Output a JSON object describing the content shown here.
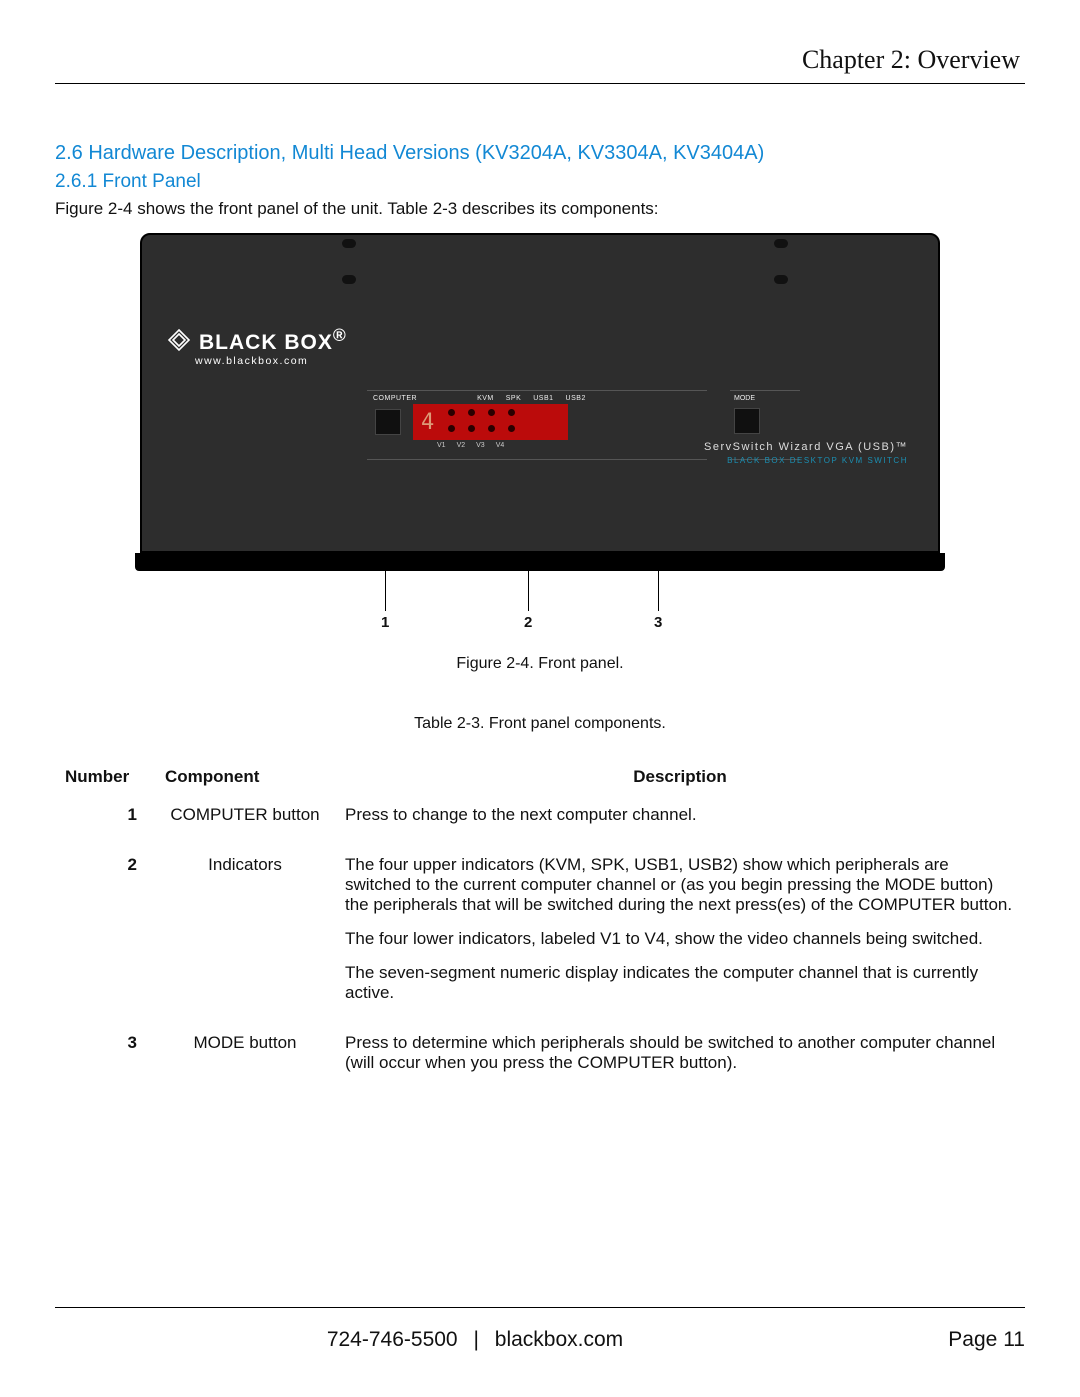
{
  "chapter_title": "Chapter 2: Overview",
  "section_heading": "2.6 Hardware Description, Multi Head Versions (KV3204A, KV3304A, KV3404A)",
  "subsection_heading": "2.6.1 Front Panel",
  "intro_text": "Figure 2-4 shows the front panel of the unit. Table 2-3 describes its components:",
  "device": {
    "brand": "BLACK BOX",
    "brand_suffix": "®",
    "url": "www.blackbox.com",
    "labels": {
      "computer": "COMPUTER",
      "kvm": "KVM",
      "spk": "SPK",
      "usb1": "USB1",
      "usb2": "USB2",
      "mode": "MODE",
      "v1": "V1",
      "v2": "V2",
      "v3": "V3",
      "v4": "V4"
    },
    "display_digit": "4",
    "product_name": "ServSwitch Wizard VGA (USB)™",
    "product_sub": "BLACK BOX DESKTOP KVM SWITCH"
  },
  "callouts": {
    "c1": "1",
    "c2": "2",
    "c3": "3"
  },
  "figure_caption": "Figure 2-4. Front panel.",
  "table_caption": "Table 2-3. Front panel components.",
  "table": {
    "headers": {
      "number": "Number",
      "component": "Component",
      "description": "Description"
    },
    "rows": [
      {
        "number": "1",
        "component": "COMPUTER button",
        "desc_paras": [
          "Press to change to the next computer channel."
        ]
      },
      {
        "number": "2",
        "component": "Indicators",
        "desc_paras": [
          "The four upper indicators (KVM, SPK, USB1, USB2) show which peripherals are switched to the current computer channel or (as you begin pressing the MODE button) the peripherals that will be switched during the next press(es) of the COMPUTER button.",
          "The four lower indicators, labeled V1 to V4, show the video channels being switched.",
          "The seven-segment numeric display indicates the computer channel that is currently active."
        ]
      },
      {
        "number": "3",
        "component": "MODE button",
        "desc_paras": [
          "Press to determine which peripherals should be switched to another computer channel (will occur when you press the COMPUTER button)."
        ]
      }
    ]
  },
  "footer": {
    "phone": "724-746-5500",
    "divider": "|",
    "site": "blackbox.com",
    "page_label": "Page",
    "page_num": "11"
  }
}
